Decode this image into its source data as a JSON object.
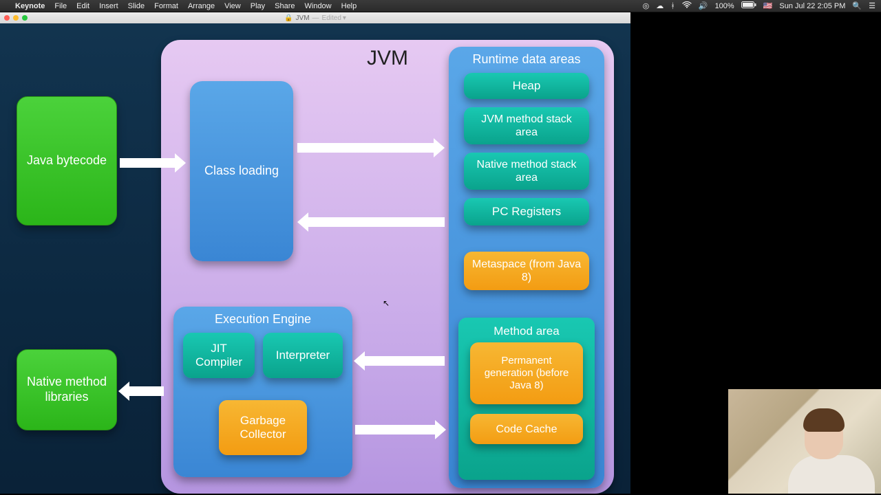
{
  "menubar": {
    "app": "Keynote",
    "items": [
      "File",
      "Edit",
      "Insert",
      "Slide",
      "Format",
      "Arrange",
      "View",
      "Play",
      "Share",
      "Window",
      "Help"
    ],
    "status": {
      "battery": "100%",
      "datetime": "Sun Jul 22  2:05 PM"
    }
  },
  "window": {
    "title_doc": "JVM",
    "title_state": "Edited"
  },
  "inputs": {
    "bytecode": "Java bytecode",
    "native_libs": "Native method libraries"
  },
  "jvm": {
    "title": "JVM",
    "class_loading": "Class loading",
    "execution_engine": {
      "title": "Execution Engine",
      "jit": "JIT Compiler",
      "interpreter": "Interpreter",
      "gc": "Garbage Collector"
    },
    "runtime": {
      "title": "Runtime data areas",
      "heap": "Heap",
      "jvm_stack": "JVM method stack area",
      "native_stack": "Native method stack area",
      "pc": "PC Registers",
      "metaspace": "Metaspace (from Java 8)",
      "method_area": {
        "title": "Method area",
        "permgen": "Permanent generation (before Java 8)",
        "code_cache": "Code Cache"
      }
    }
  }
}
